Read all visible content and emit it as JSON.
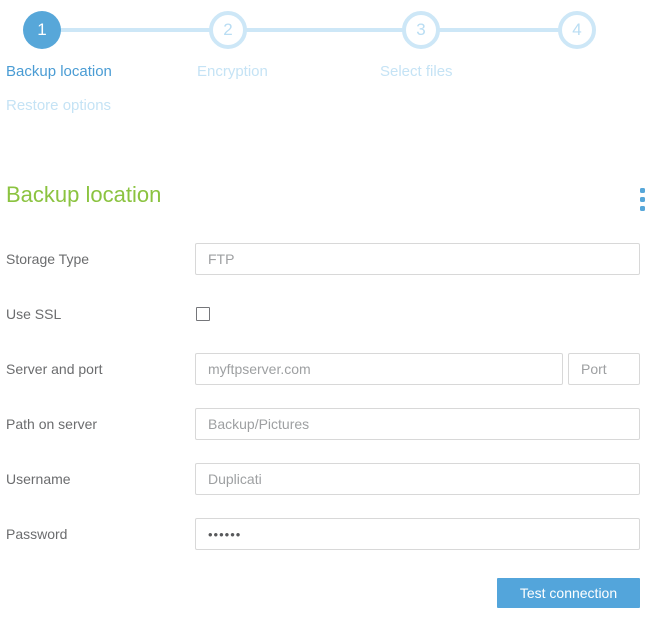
{
  "stepper": {
    "steps": [
      {
        "number": "1",
        "label": "Backup location",
        "state": "active"
      },
      {
        "number": "2",
        "label": "Encryption",
        "state": "upcoming"
      },
      {
        "number": "3",
        "label": "Select files",
        "state": "upcoming"
      },
      {
        "number": "4",
        "label": "Restore options",
        "state": "upcoming"
      }
    ]
  },
  "section": {
    "title": "Backup location"
  },
  "form": {
    "storage_type": {
      "label": "Storage Type",
      "value": "FTP"
    },
    "use_ssl": {
      "label": "Use SSL",
      "checked": false
    },
    "server_port": {
      "label": "Server and port",
      "server_value": "myftpserver.com",
      "port_placeholder": "Port"
    },
    "path": {
      "label": "Path on server",
      "value": "Backup/Pictures"
    },
    "username": {
      "label": "Username",
      "value": "Duplicati"
    },
    "password": {
      "label": "Password",
      "masked_value": "••••••"
    }
  },
  "actions": {
    "test_connection_label": "Test connection"
  },
  "colors": {
    "active_step_blue": "#57a7d9",
    "inactive_step_blue": "#cde7f7",
    "active_label_blue": "#4a9cd4",
    "heading_green": "#8bc340",
    "button_blue": "#53a5db",
    "label_gray": "#6b6c6e",
    "input_text_gray": "#9ea0a2",
    "input_border_gray": "#d8d8d8"
  }
}
